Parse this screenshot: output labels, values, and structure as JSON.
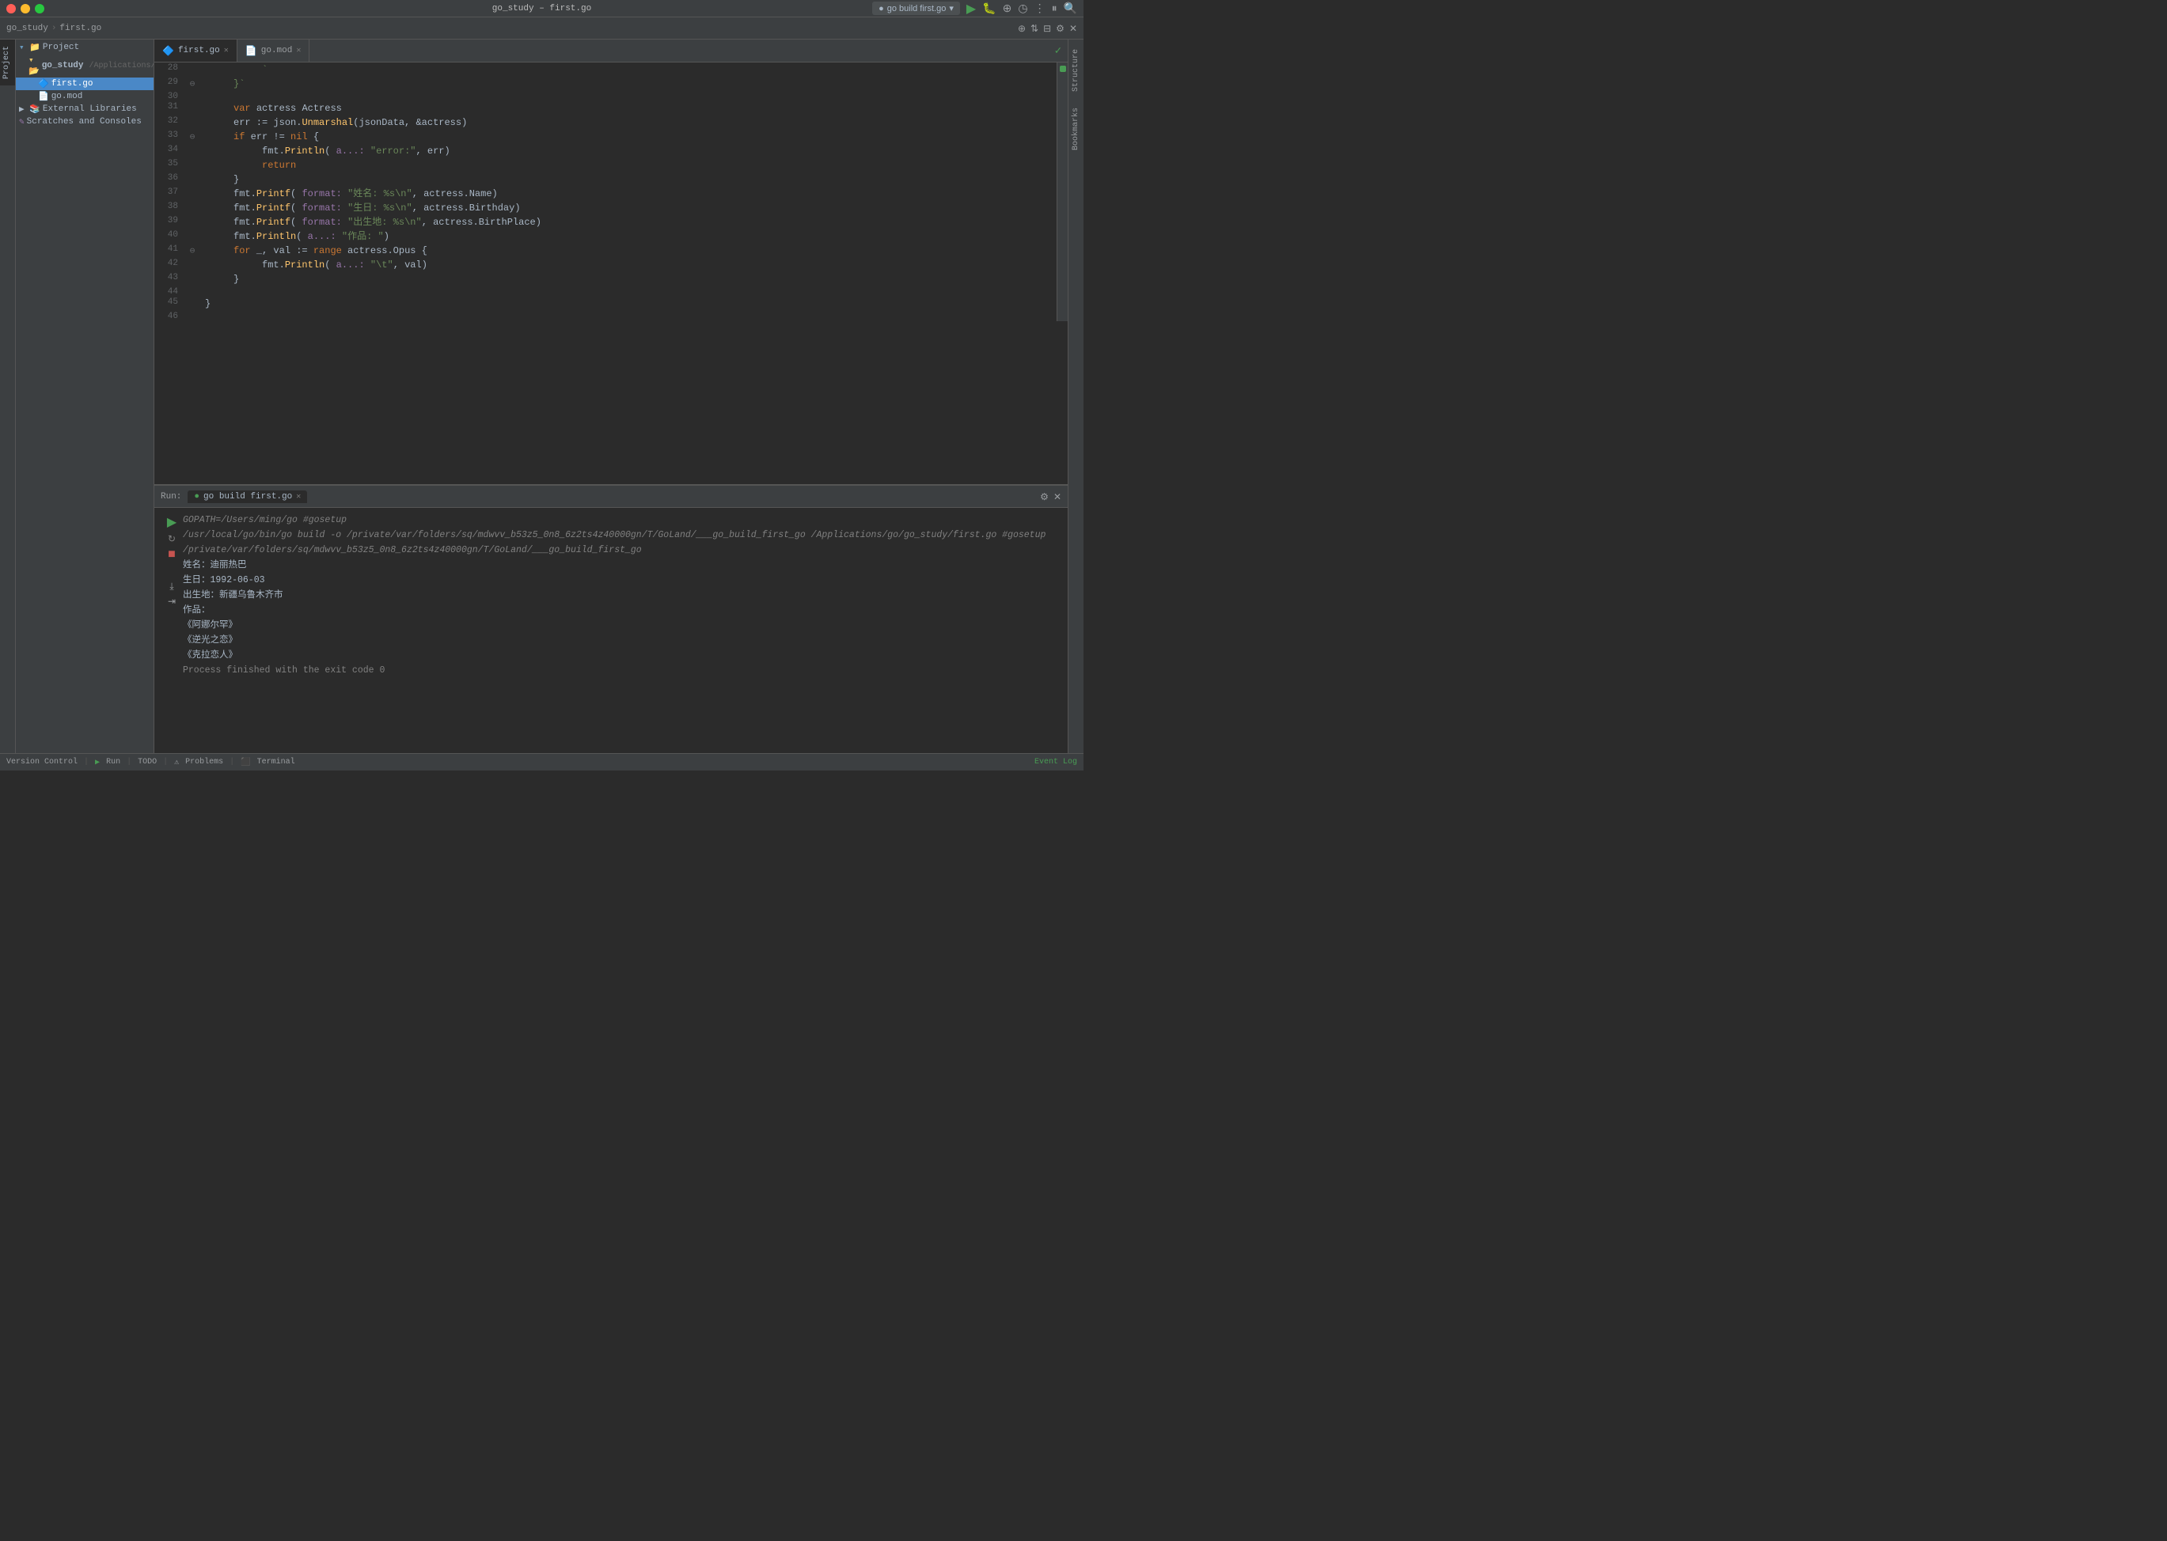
{
  "titlebar": {
    "title": "go_study – first.go"
  },
  "toolbar": {
    "breadcrumb_project": "go_study",
    "breadcrumb_file": "first.go",
    "run_config": "go build first.go",
    "btn_run_label": "▶"
  },
  "project_panel": {
    "title": "Project",
    "root_name": "go_study",
    "root_path": "/Applications/go/go_study",
    "items": [
      {
        "label": "go_study",
        "type": "folder",
        "level": 0,
        "expanded": true
      },
      {
        "label": "first.go",
        "type": "file_go",
        "level": 1,
        "selected": true
      },
      {
        "label": "go.mod",
        "type": "file_mod",
        "level": 1
      },
      {
        "label": "External Libraries",
        "type": "folder_ext",
        "level": 0,
        "expanded": false
      },
      {
        "label": "Scratches and Consoles",
        "type": "folder_scratch",
        "level": 0
      }
    ]
  },
  "editor": {
    "tabs": [
      {
        "label": "first.go",
        "type": "go",
        "active": true
      },
      {
        "label": "go.mod",
        "type": "mod",
        "active": false
      }
    ],
    "lines": [
      {
        "num": 28,
        "gutter": "",
        "content": "          `"
      },
      {
        "num": 29,
        "gutter": "⊖",
        "content": "     }`"
      },
      {
        "num": 30,
        "gutter": "",
        "content": ""
      },
      {
        "num": 31,
        "gutter": "",
        "content": "     var actress Actress"
      },
      {
        "num": 32,
        "gutter": "",
        "content": "     err := json.Unmarshal(jsonData, &actress)"
      },
      {
        "num": 33,
        "gutter": "⊖",
        "content": "     if err != nil {"
      },
      {
        "num": 34,
        "gutter": "",
        "content": "          fmt.Println( a...: \"error:\", err)"
      },
      {
        "num": 35,
        "gutter": "",
        "content": "          return"
      },
      {
        "num": 36,
        "gutter": "",
        "content": "     }"
      },
      {
        "num": 37,
        "gutter": "",
        "content": "     fmt.Printf( format: \"姓名: %s\\n\", actress.Name)"
      },
      {
        "num": 38,
        "gutter": "",
        "content": "     fmt.Printf( format: \"生日: %s\\n\", actress.Birthday)"
      },
      {
        "num": 39,
        "gutter": "",
        "content": "     fmt.Printf( format: \"出生地: %s\\n\", actress.BirthPlace)"
      },
      {
        "num": 40,
        "gutter": "",
        "content": "     fmt.Println( a...: \"作品: \")"
      },
      {
        "num": 41,
        "gutter": "⊖",
        "content": "     for _, val := range actress.Opus {"
      },
      {
        "num": 42,
        "gutter": "",
        "content": "          fmt.Println( a...: \"\\t\", val)"
      },
      {
        "num": 43,
        "gutter": "",
        "content": "     }"
      },
      {
        "num": 44,
        "gutter": "",
        "content": ""
      },
      {
        "num": 45,
        "gutter": "",
        "content": "}"
      },
      {
        "num": 46,
        "gutter": "",
        "content": ""
      }
    ]
  },
  "run_panel": {
    "label": "Run:",
    "tab_label": "go build first.go",
    "output_lines": [
      {
        "type": "cmd",
        "text": "GOPATH=/Users/ming/go  #gosetup"
      },
      {
        "type": "cmd",
        "text": "/usr/local/go/bin/go build -o /private/var/folders/sq/mdwvv_b53z5_0n8_6z2ts4z40000gn/T/GoLand/___go_build_first_go /Applications/go/go_study/first.go  #gosetup"
      },
      {
        "type": "cmd",
        "text": "/private/var/folders/sq/mdwvv_b53z5_0n8_6z2ts4z40000gn/T/GoLand/___go_build_first_go"
      },
      {
        "type": "output",
        "text": "姓名：迪丽热巴"
      },
      {
        "type": "output",
        "text": "生日：1992-06-03"
      },
      {
        "type": "output",
        "text": "出生地：新疆乌鲁木齐市"
      },
      {
        "type": "output",
        "text": "作品："
      },
      {
        "type": "output",
        "text": "       《阿娜尔罕》"
      },
      {
        "type": "output",
        "text": "       《逆光之恋》"
      },
      {
        "type": "output",
        "text": "       《克拉恋人》"
      },
      {
        "type": "output",
        "text": ""
      },
      {
        "type": "process",
        "text": "Process finished with the exit code 0"
      }
    ]
  },
  "status_bar": {
    "version_control": "Version Control",
    "run_label": "Run",
    "todo_label": "TODO",
    "problems_label": "Problems",
    "terminal_label": "Terminal",
    "event_log": "Event Log"
  }
}
